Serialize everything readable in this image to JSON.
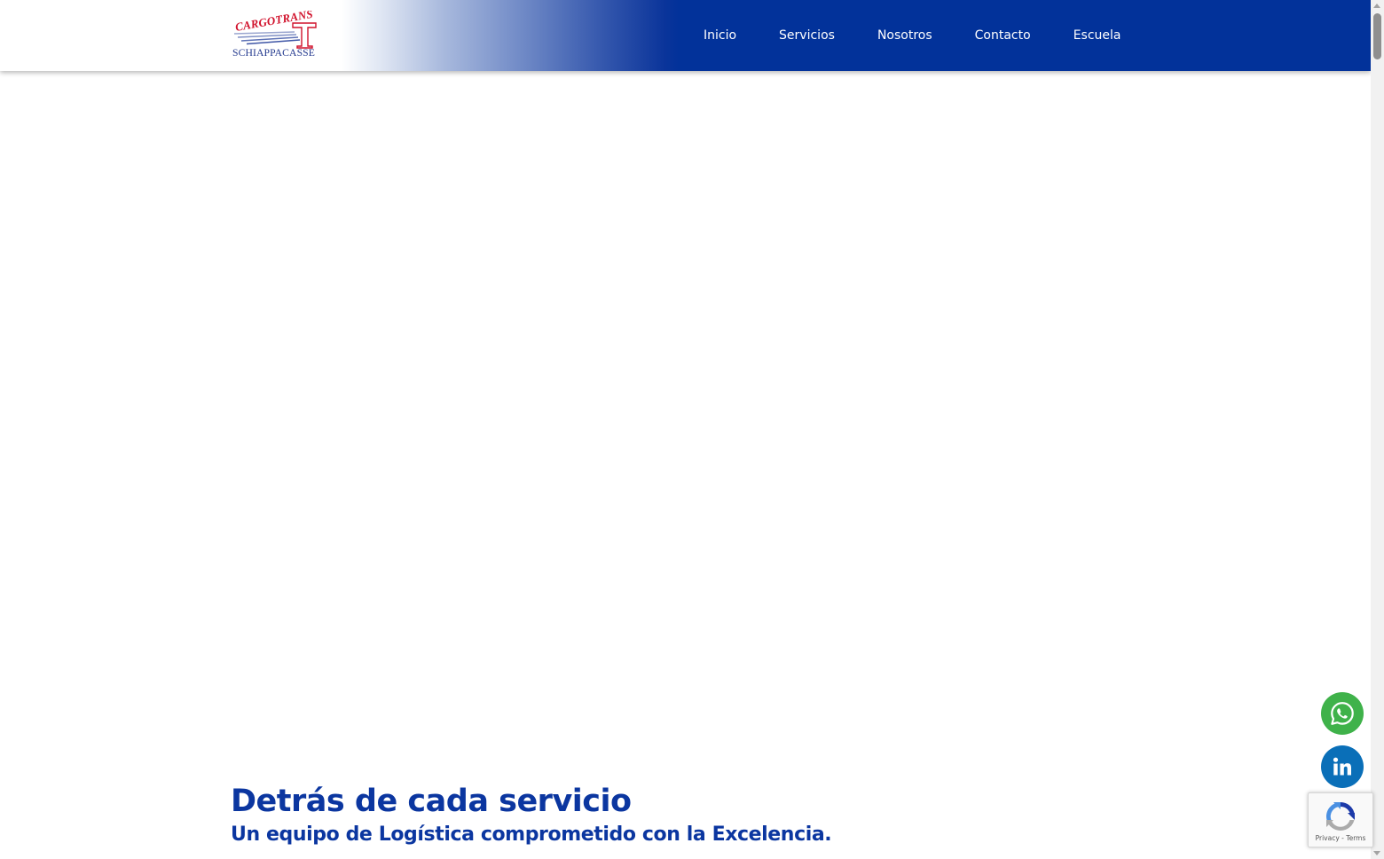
{
  "brand": {
    "logo_top": "CARGOTRANS",
    "logo_bottom": "SCHIAPPACASSE",
    "primary_color": "#02329a",
    "accent_color": "#d1122c"
  },
  "nav": {
    "items": [
      {
        "label": "Inicio"
      },
      {
        "label": "Servicios"
      },
      {
        "label": "Nosotros"
      },
      {
        "label": "Contacto"
      },
      {
        "label": "Escuela"
      }
    ]
  },
  "hero": {
    "title": "Detrás de cada servicio",
    "subtitle": "Un equipo de Logística comprometido con la Excelencia."
  },
  "floating_buttons": {
    "whatsapp_icon": "whatsapp-icon",
    "whatsapp_color": "#3fb24a",
    "linkedin_icon": "linkedin-icon",
    "linkedin_color": "#0a6fb8"
  },
  "recaptcha": {
    "privacy": "Privacy",
    "separator": "-",
    "terms": "Terms"
  }
}
